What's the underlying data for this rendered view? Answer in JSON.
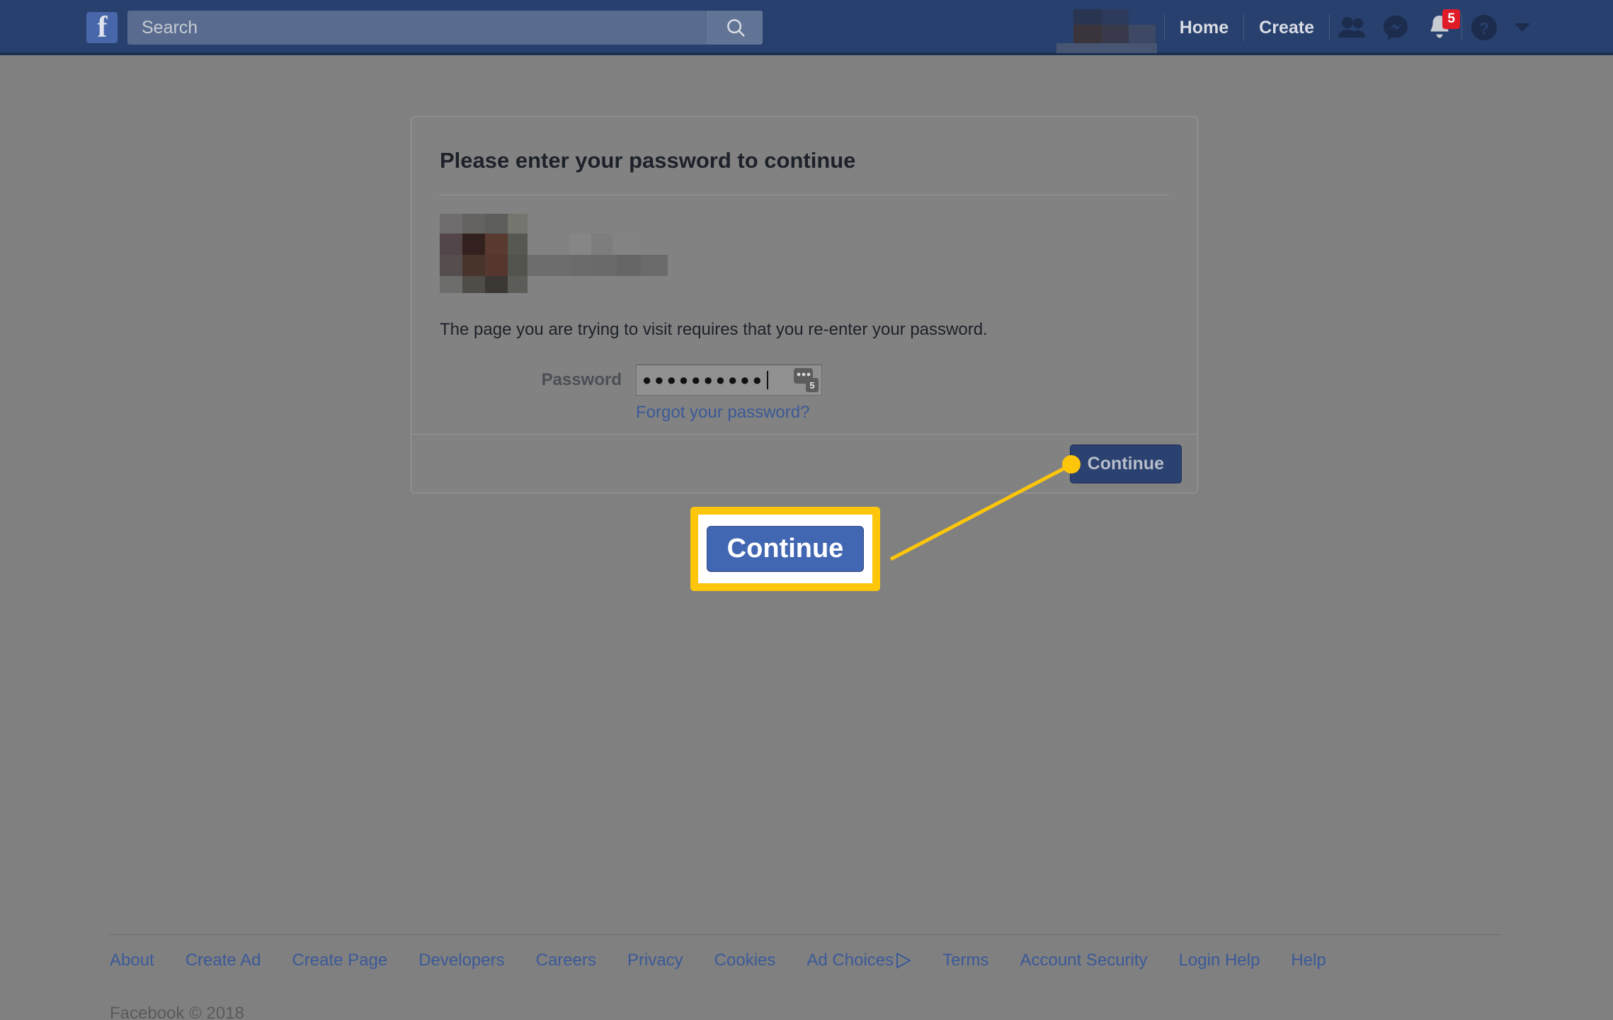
{
  "topbar": {
    "logo_letter": "f",
    "logo_icon": "facebook-logo",
    "search": {
      "placeholder": "Search",
      "value": "",
      "icon": "search-icon"
    },
    "profile_name_redacted": "",
    "links": [
      {
        "label": "Home",
        "name": "home"
      },
      {
        "label": "Create",
        "name": "create"
      }
    ],
    "icons": [
      {
        "name": "friend-requests-icon",
        "glyph": "people"
      },
      {
        "name": "messenger-icon",
        "glyph": "messenger"
      },
      {
        "name": "notifications-icon",
        "glyph": "bell",
        "badge": "5"
      },
      {
        "name": "help-icon",
        "glyph": "question"
      },
      {
        "name": "account-menu-icon",
        "glyph": "chevron-down"
      }
    ],
    "notification_count": "5",
    "colors": {
      "bar": "#27406e",
      "bar_border": "#1d2f52",
      "badge": "#e01b28",
      "logo_tile": "#4867aa"
    }
  },
  "dialog": {
    "title": "Please enter your password to continue",
    "avatar_redacted": "",
    "notice": "The page you are trying to visit requires that you re-enter your password.",
    "password": {
      "label": "Password",
      "value": "●●●●●●●●●●",
      "char_count": 10,
      "placeholder": "",
      "manager_icon": "password-manager-icon",
      "manager_badge": "5"
    },
    "forgot_link": "Forgot your password?",
    "continue_label": "Continue"
  },
  "annotation": {
    "magnified_label": "Continue",
    "highlight_color": "#fdc60b",
    "line_color": "#fdc60b",
    "button_color": "#4267b2"
  },
  "footer": {
    "links": [
      "About",
      "Create Ad",
      "Create Page",
      "Developers",
      "Careers",
      "Privacy",
      "Cookies",
      "Ad Choices",
      "Terms",
      "Account Security",
      "Login Help",
      "Help"
    ],
    "adchoices_icon": "ad-choices-icon",
    "copyright": "Facebook © 2018",
    "link_color": "#3b5998"
  }
}
